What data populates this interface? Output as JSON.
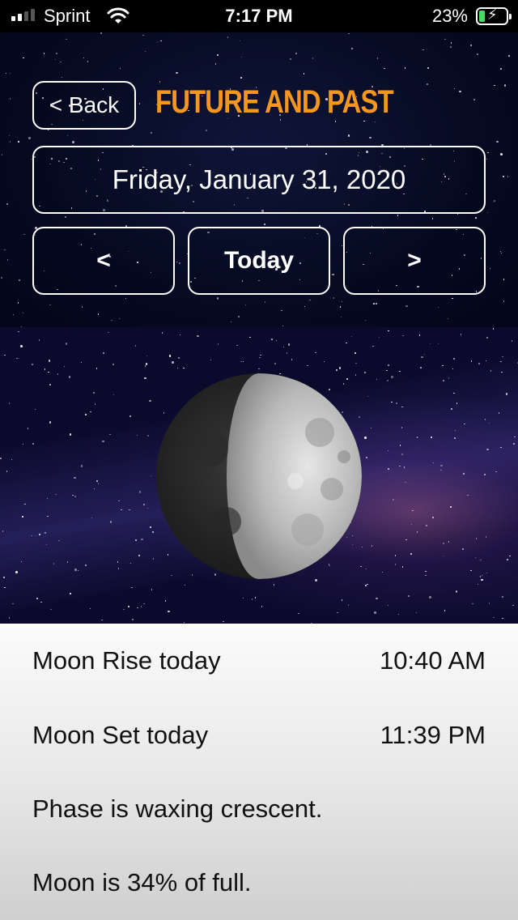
{
  "status_bar": {
    "carrier": "Sprint",
    "time": "7:17 PM",
    "battery_percent": "23%",
    "signal_bars": 2,
    "battery_level": 0.23,
    "charging": true,
    "icons": [
      "signal-icon",
      "wifi-icon",
      "battery-icon",
      "charging-bolt-icon"
    ]
  },
  "header": {
    "back_label": "< Back",
    "title": "Future and Past",
    "title_color": "#f5961e"
  },
  "date_selector": {
    "date_label": "Friday, January 31, 2020",
    "prev_label": "<",
    "today_label": "Today",
    "next_label": ">"
  },
  "moon": {
    "phase": "waxing crescent",
    "illumination": 0.34
  },
  "info": {
    "rise_label": "Moon Rise today",
    "rise_value": "10:40 AM",
    "set_label": "Moon Set today",
    "set_value": "11:39 PM",
    "phase_text": "Phase is waxing crescent.",
    "percent_text": "Moon is 34% of full."
  }
}
